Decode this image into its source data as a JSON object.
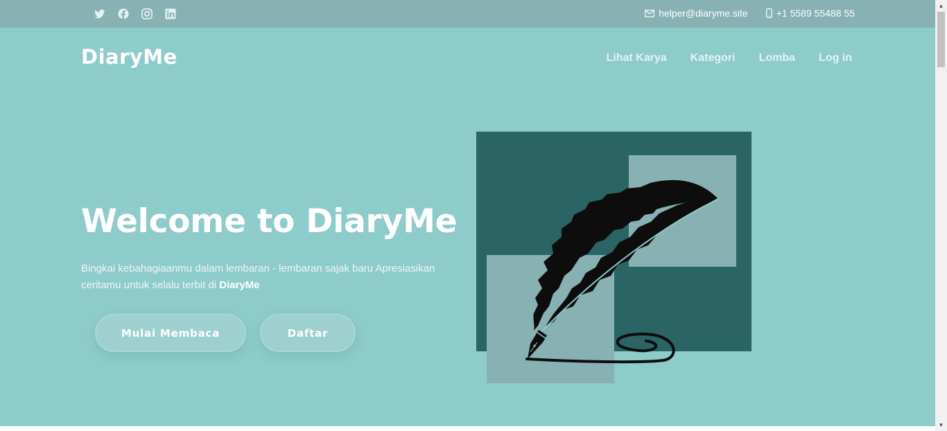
{
  "topbar": {
    "social_icons": [
      "twitter-icon",
      "facebook-icon",
      "instagram-icon",
      "linkedin-icon"
    ],
    "email": "helper@diaryme.site",
    "phone": "+1 5589 55488 55"
  },
  "header": {
    "brand": "DiaryMe",
    "nav": [
      "Lihat Karya",
      "Kategori",
      "Lomba",
      "Log in"
    ]
  },
  "hero": {
    "title": "Welcome to DiaryMe",
    "description": "Bingkai kebahagiaanmu dalam lembaran - lembaran sajak baru Apresiasikan ceritamu untuk selalu terbit di ",
    "description_bold": "DiaryMe",
    "primary_button": "Mulai Membaca",
    "secondary_button": "Daftar",
    "illustration": "feather-quill-illustration"
  },
  "colors": {
    "topbar_bg": "#87b1b3",
    "hero_bg": "#8ecbcb",
    "illustration_dark": "#2a6464",
    "illustration_light": "#87b1b3"
  }
}
